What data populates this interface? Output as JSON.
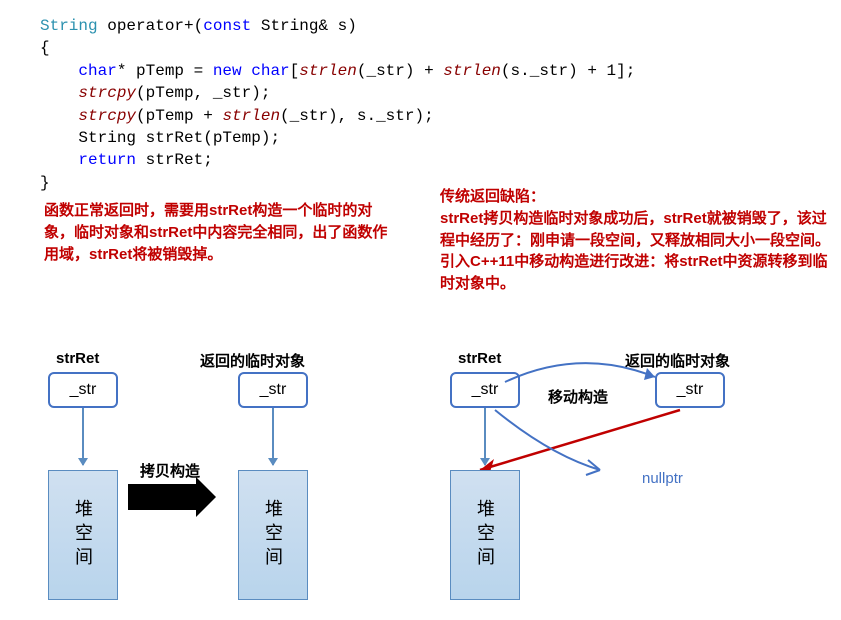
{
  "code": {
    "l1a": "String",
    "l1b": " operator+(",
    "l1c": "const",
    "l1d": " String& s)",
    "l2": "{",
    "l3a": "    ",
    "l3b": "char",
    "l3c": "* pTemp = ",
    "l3d": "new",
    "l3e": " ",
    "l3f": "char",
    "l3g": "[",
    "l3h": "strlen",
    "l3i": "(_str) + ",
    "l3j": "strlen",
    "l3k": "(s._str) + 1];",
    "l4a": "    ",
    "l4b": "strcpy",
    "l4c": "(pTemp, _str);",
    "l5a": "    ",
    "l5b": "strcpy",
    "l5c": "(pTemp + ",
    "l5d": "strlen",
    "l5e": "(_str), s._str);",
    "l6a": "    String strRet(pTemp);",
    "l7a": "    ",
    "l7b": "return",
    "l7c": " strRet;",
    "l8": "}"
  },
  "notes": {
    "left": "函数正常返回时，需要用strRet构造一个临时的对象，临时对象和strRet中内容完全相同，出了函数作用域，strRet将被销毁掉。",
    "right_title": "传统返回缺陷：",
    "right_body": "strRet拷贝构造临时对象成功后，strRet就被销毁了，该过程中经历了：刚申请一段空间，又释放相同大小一段空间。引入C++11中移动构造进行改进：将strRet中资源转移到临时对象中。"
  },
  "labels": {
    "strRet": "strRet",
    "temp_obj": "返回的临时对象",
    "str_field": "_str",
    "heap": "堆空间",
    "copy_ctor": "拷贝构造",
    "move_ctor": "移动构造",
    "nullptr": "nullptr"
  }
}
